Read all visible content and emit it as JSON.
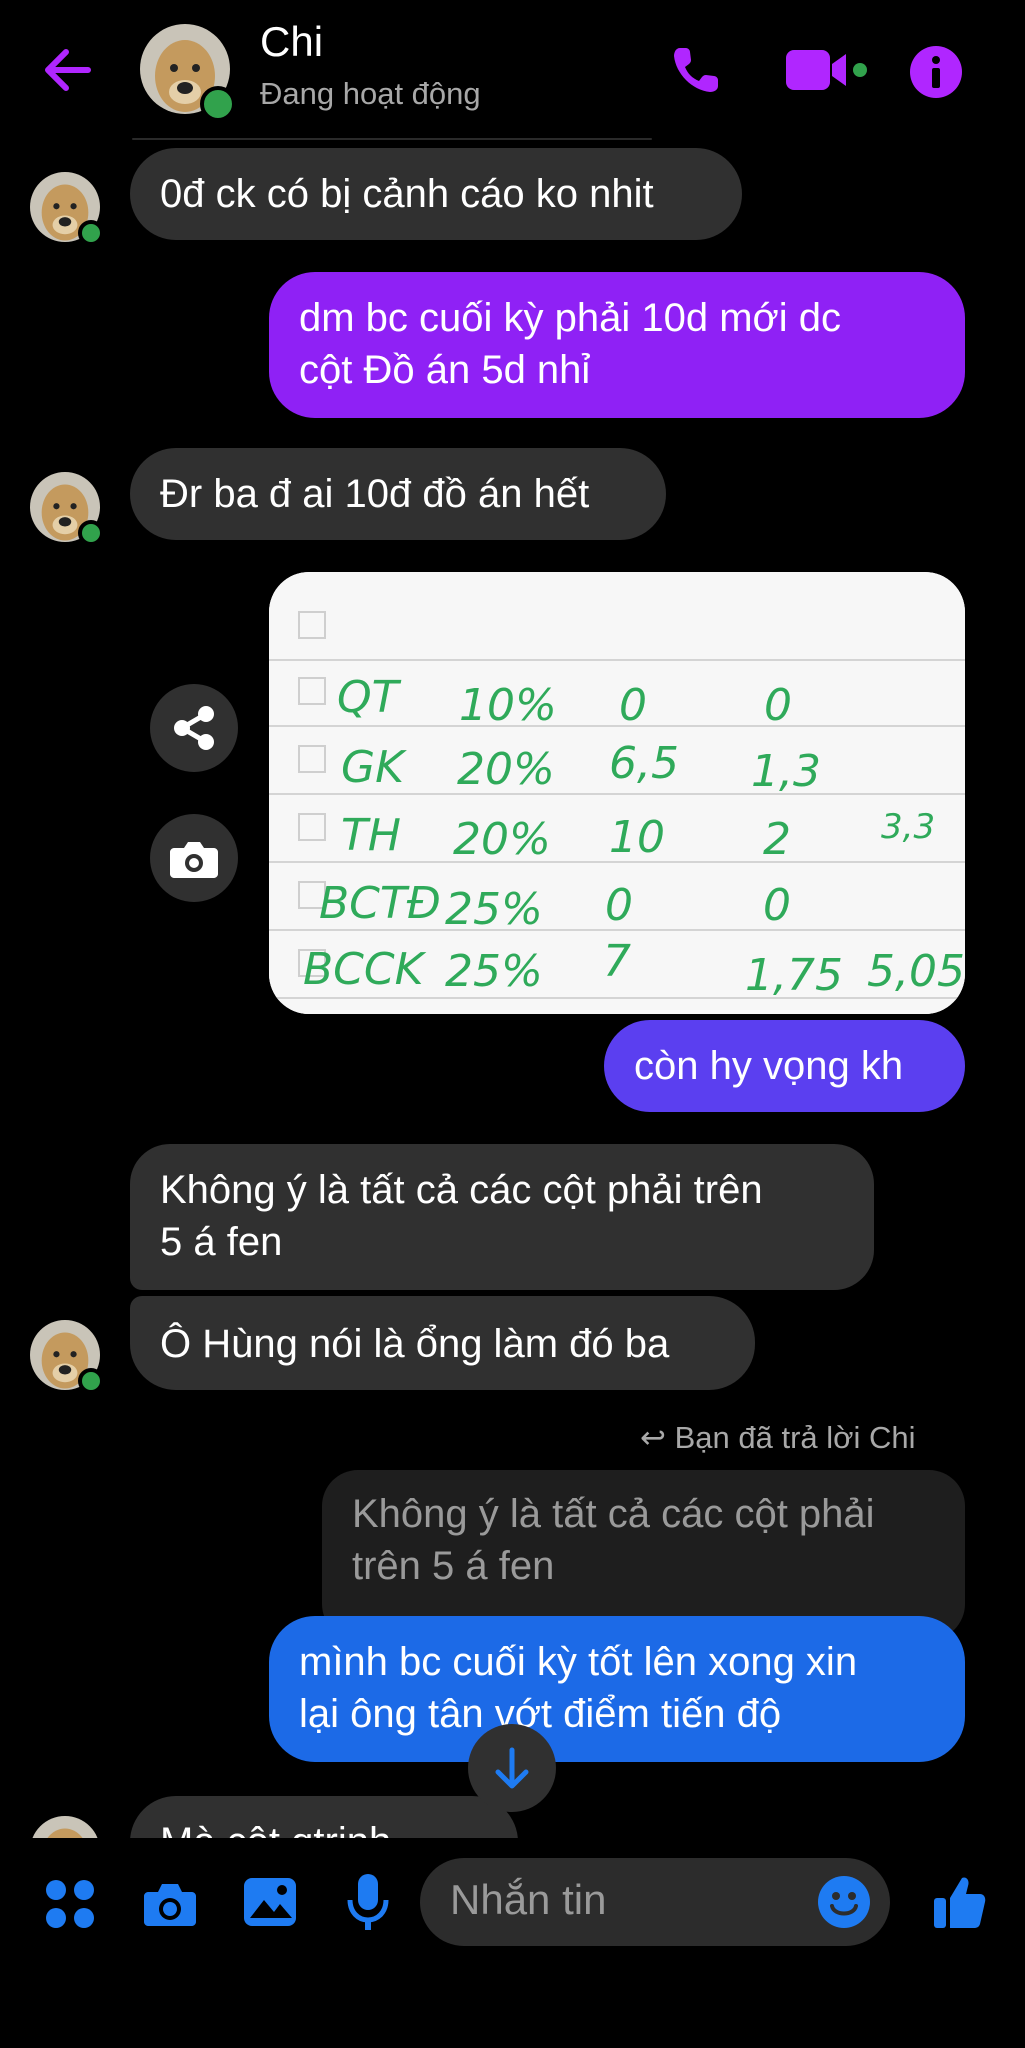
{
  "header": {
    "title": "Chi",
    "status": "Đang hoạt động"
  },
  "colors": {
    "accent_purple": "#b026ff",
    "bubble_purple": "#8f21f5",
    "bubble_violet": "#5b3ff0",
    "bubble_blue": "#1c6ae7",
    "bubble_received": "#303030",
    "online_green": "#31a24c",
    "composer_blue": "#1e7bf2"
  },
  "messages": [
    {
      "from": "Chi",
      "line1": "0đ ck có bị cảnh cáo ko nhit"
    },
    {
      "from": "me",
      "line1": "dm bc cuối kỳ phải 10d mới dc",
      "line2": "cột Đồ án 5d nhỉ"
    },
    {
      "from": "Chi",
      "line1": "Đr ba đ ai 10đ đồ án hết"
    },
    {
      "from": "me",
      "line1": "còn hy vọng kh"
    },
    {
      "from": "Chi",
      "line1": "Không ý là tất cả các cột phải trên",
      "line2": "5 á fen"
    },
    {
      "from": "Chi",
      "line1": "Ô Hùng nói là ổng làm đó ba"
    },
    {
      "from": "me",
      "line1": "mình bc cuối kỳ tốt lên xong xin",
      "line2": "lại ông tân vớt điểm tiến độ"
    },
    {
      "from": "Chi",
      "line1": "Mà cột qtrinh"
    }
  ],
  "reply": {
    "label": "Bạn đã trả lời Chi",
    "quoted_line1": "Không ý là tất cả các cột phải",
    "quoted_line2": "trên 5 á fen"
  },
  "photo_notes": {
    "rows": [
      {
        "name": "QT",
        "weight": "10%",
        "score": "0",
        "weighted": "0",
        "total": ""
      },
      {
        "name": "GK",
        "weight": "20%",
        "score": "6,5",
        "weighted": "1,3",
        "total": ""
      },
      {
        "name": "TH",
        "weight": "20%",
        "score": "10",
        "weighted": "2",
        "total": "3,3"
      },
      {
        "name": "BCTĐ",
        "weight": "25%",
        "score": "0",
        "weighted": "0",
        "total": ""
      },
      {
        "name": "BCCK",
        "weight": "25%",
        "score": "7",
        "weighted": "1,75",
        "total": "5,05"
      }
    ]
  },
  "composer": {
    "placeholder": "Nhắn tin"
  },
  "icons": {
    "back": "arrow-left-icon",
    "call": "phone-icon",
    "video": "video-camera-icon",
    "info": "info-icon",
    "share": "share-icon",
    "camera": "camera-icon",
    "scroll": "arrow-down-icon",
    "menu": "grid-dots-icon",
    "gallery": "image-icon",
    "mic": "microphone-icon",
    "emoji": "smiley-icon",
    "like": "thumbs-up-icon"
  }
}
